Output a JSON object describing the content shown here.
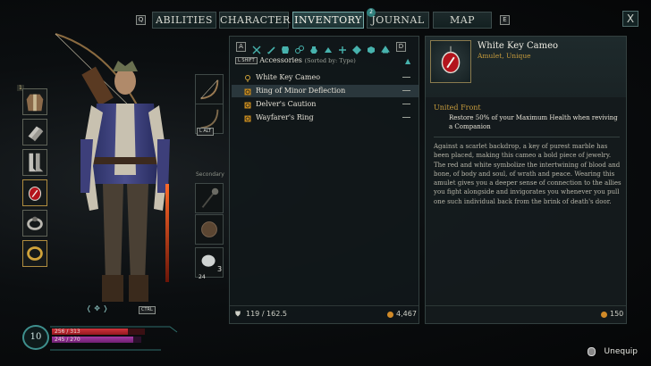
{
  "nav": {
    "left_key": "Q",
    "right_key": "E",
    "tabs": [
      {
        "label": "ABILITIES",
        "active": false
      },
      {
        "label": "CHARACTER",
        "active": false
      },
      {
        "label": "INVENTORY",
        "active": true
      },
      {
        "label": "JOURNAL",
        "active": false,
        "badge": "2"
      },
      {
        "label": "MAP",
        "active": false
      }
    ],
    "close_label": "X"
  },
  "equipment": {
    "slot_key": "1",
    "slots": [
      "chest-armor-icon",
      "gloves-icon",
      "boots-icon",
      "amulet-icon",
      "ring-icon",
      "gold-ring-icon"
    ],
    "secondary_label": "Secondary",
    "swap_key": "L ALT",
    "consumable_count": "3",
    "consumable_stack": "24",
    "rotate_key": "CTRL"
  },
  "inventory": {
    "filter_left_key": "A",
    "filter_right_key": "D",
    "sort_key": "L SHIFT",
    "category": "Accessories",
    "sort_note": "(Sorted by: Type)",
    "items": [
      {
        "name": "White Key Cameo",
        "icon": "amulet-icon",
        "selected": false
      },
      {
        "name": "Ring of Minor Deflection",
        "icon": "ring-icon",
        "selected": true
      },
      {
        "name": "Delver's Caution",
        "icon": "ring-icon",
        "selected": false
      },
      {
        "name": "Wayfarer's Ring",
        "icon": "ring-icon",
        "selected": false
      }
    ],
    "weight": "119 / 162.5",
    "gold": "4,467"
  },
  "detail": {
    "title": "White Key Cameo",
    "subtitle": "Amulet, Unique",
    "ability_name": "United Front",
    "ability_text": "Restore 50% of your Maximum Health when reviving a Companion",
    "lore": "Against a scarlet backdrop, a key of purest marble has been placed, making this cameo a bold piece of jewelry. The red and white symbolize the intertwining of blood and bone, of body and soul, of wrath and peace. Wearing this amulet gives you a deeper sense of connection to the allies you fight alongside and invigorates you whenever you pull one such individual back from the brink of death's door.",
    "value": "150"
  },
  "stats": {
    "level": "10",
    "health": "256 / 313",
    "health_fraction": 0.82,
    "essence": "245 / 270",
    "essence_fraction": 0.91
  },
  "hint": {
    "unequip_label": "Unequip"
  },
  "colors": {
    "accent_teal": "#3e8f8d",
    "gold": "#c59a3c",
    "health": "#b8202a",
    "essence": "#8c2a8e"
  }
}
